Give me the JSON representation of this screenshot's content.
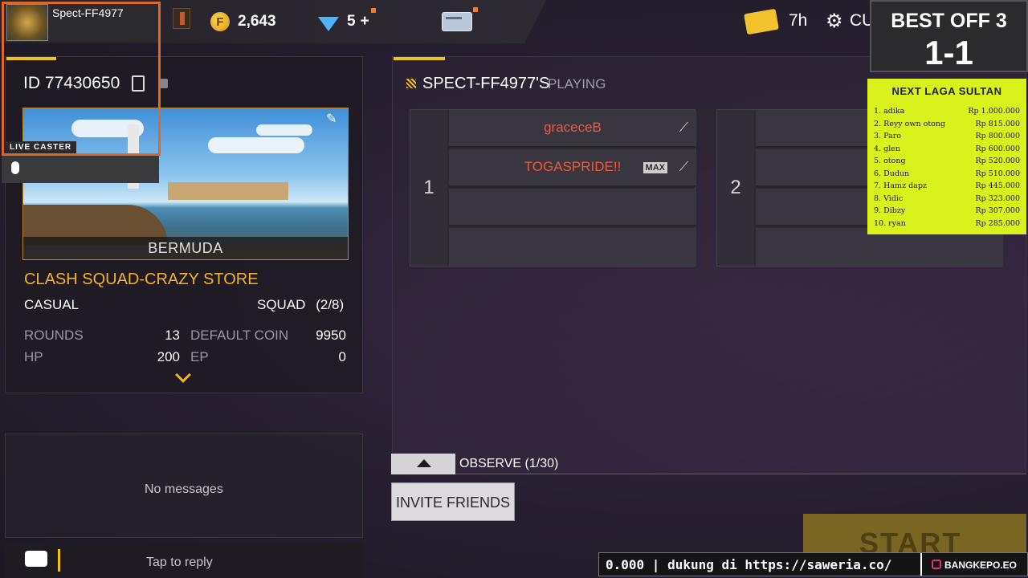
{
  "player": {
    "name": "Spect-FF4977",
    "id_label": "ID",
    "id": "77430650"
  },
  "currency": {
    "coins": "2,643",
    "diamonds": "5",
    "plus": "+"
  },
  "topbar": {
    "time": "7h",
    "settings_short": "CU"
  },
  "caster": {
    "label": "LIVE CASTER"
  },
  "match": {
    "map_name": "BERMUDA",
    "mode_title": "CLASH SQUAD-CRAZY STORE",
    "room_type": "CASUAL",
    "squad_label": "SQUAD",
    "squad_count": "(2/8)",
    "stats": [
      {
        "label": "ROUNDS",
        "value": "13"
      },
      {
        "label": "DEFAULT COIN",
        "value": "9950"
      },
      {
        "label": "HP",
        "value": "200"
      },
      {
        "label": "EP",
        "value": "0"
      }
    ]
  },
  "chat": {
    "empty": "No messages",
    "reply_hint": "Tap to reply"
  },
  "lobby": {
    "owner_title": "SPECT-FF4977'S",
    "status": "PLAYING",
    "team1": {
      "number": "1",
      "players": [
        "graceceB",
        "TOGASPRIDE!!"
      ],
      "max_tag": "MAX"
    },
    "team2": {
      "number": "2"
    },
    "observe_label": "OBSERVE (1/30)",
    "invite_label": "INVITE FRIENDS",
    "start_label": "START"
  },
  "scoreboard": {
    "title": "BEST OFF 3",
    "score": "1-1"
  },
  "leaderboard": {
    "title": "NEXT LAGA SULTAN",
    "rows": [
      {
        "rank": "1.",
        "name": "adika",
        "amount": "Rp 1.000.000"
      },
      {
        "rank": "2.",
        "name": "Reyy own otong",
        "amount": "Rp 815.000"
      },
      {
        "rank": "3.",
        "name": "Paro",
        "amount": "Rp 800.000"
      },
      {
        "rank": "4.",
        "name": "glen",
        "amount": "Rp 600.000"
      },
      {
        "rank": "5.",
        "name": "otong",
        "amount": "Rp 520.000"
      },
      {
        "rank": "6.",
        "name": "Dudun",
        "amount": "Rp 510.000"
      },
      {
        "rank": "7.",
        "name": "Hamz dapz",
        "amount": "Rp 445.000"
      },
      {
        "rank": "8.",
        "name": "Vidic",
        "amount": "Rp 323.000"
      },
      {
        "rank": "9.",
        "name": "Dibzy",
        "amount": "Rp 307.000"
      },
      {
        "rank": "10.",
        "name": "ryan",
        "amount": "Rp 285.000"
      }
    ]
  },
  "ticker": {
    "text": "0.000 |  dukung di https://saweria.co/",
    "handle": "BANGKEPO.EO"
  },
  "colors": {
    "accent": "#f1c40f",
    "orange_frame": "#e0672a",
    "leaderboard_bg": "#d9f11c",
    "player_name": "#f05a3a"
  }
}
